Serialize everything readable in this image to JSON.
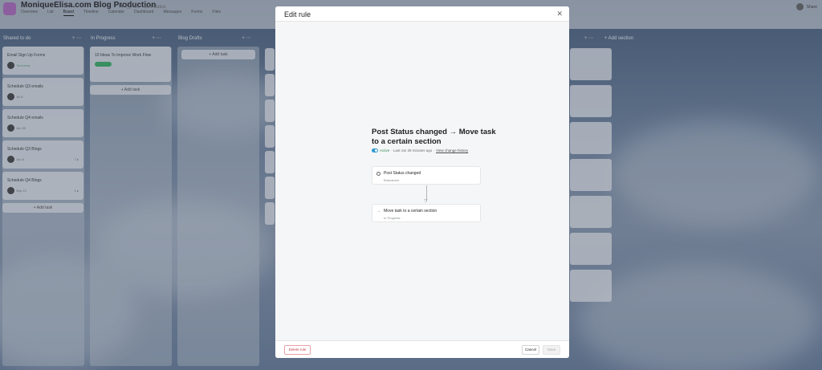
{
  "app": {
    "project_title": "MoniqueElisa.com Blog Production",
    "status": "Set status",
    "tabs": [
      "Overview",
      "List",
      "Board",
      "Timeline",
      "Calendar",
      "Dashboard",
      "Messages",
      "Forms",
      "Files"
    ],
    "active_tab": "Board",
    "share_label": "Share",
    "columns": [
      {
        "name": "Shared to do",
        "cards": [
          {
            "title": "Email Sign Up Forms",
            "date": "Tomorrow",
            "meta": ""
          },
          {
            "title": "Schedule Q3 emails",
            "date": "Jul 8",
            "meta": ""
          },
          {
            "title": "Schedule Q4 emails",
            "date": "Jun 30",
            "meta": ""
          },
          {
            "title": "Schedule Q3 Blogs",
            "date": "Jun 8",
            "meta": "7 ▸"
          },
          {
            "title": "Schedule Q4 Blogs",
            "date": "Sep 22",
            "meta": "1 ▸"
          }
        ]
      },
      {
        "name": "In Progress",
        "cards": [
          {
            "title": "10 Ideas To Improve Work Flow",
            "date": "",
            "meta": ""
          }
        ]
      },
      {
        "name": "Blog Drafts",
        "cards": []
      }
    ],
    "add_task_label": "+ Add task",
    "add_section_label": "+ Add section"
  },
  "modal": {
    "title": "Edit rule",
    "rule_title": "Post Status changed → Move task to a certain section",
    "status_label": "Active",
    "last_run": "· Last ran 39 minutes ago ·",
    "history_link": "View change history",
    "trigger": {
      "title": "Post Status changed",
      "subtitle": "Brainstorm"
    },
    "action": {
      "title": "Move task to a certain section",
      "subtitle": "In Progress"
    },
    "delete_label": "Delete rule",
    "cancel_label": "Cancel",
    "save_label": "Save",
    "colors": {
      "accent_toggle": "#2f9bd1",
      "delete_red": "#c9404e"
    }
  }
}
